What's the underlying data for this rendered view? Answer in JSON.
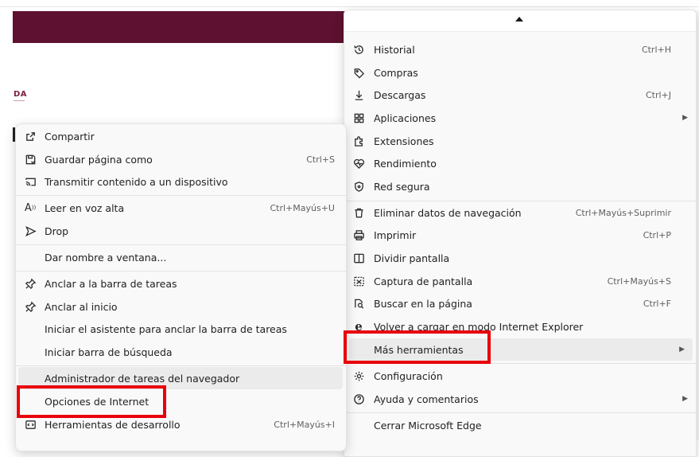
{
  "page": {
    "logo_text": "DA"
  },
  "context_menu": {
    "items": [
      {
        "icon": "share-icon",
        "label": "Compartir",
        "shortcut": ""
      },
      {
        "icon": "save-page-icon",
        "label": "Guardar página como",
        "shortcut": "Ctrl+S"
      },
      {
        "icon": "cast-icon",
        "label": "Transmitir contenido a un dispositivo",
        "shortcut": ""
      },
      {
        "icon": "read-aloud-icon",
        "label": "Leer en voz alta",
        "shortcut": "Ctrl+Mayús+U"
      },
      {
        "icon": "drop-icon",
        "label": "Drop",
        "shortcut": ""
      },
      {
        "icon": "",
        "label": "Dar nombre a ventana...",
        "shortcut": ""
      },
      {
        "icon": "pin-icon",
        "label": "Anclar a la barra de tareas",
        "shortcut": ""
      },
      {
        "icon": "pin-icon",
        "label": "Anclar al inicio",
        "shortcut": ""
      },
      {
        "icon": "",
        "label": "Iniciar el asistente para anclar la barra de tareas",
        "shortcut": ""
      },
      {
        "icon": "",
        "label": "Iniciar barra de búsqueda",
        "shortcut": ""
      },
      {
        "icon": "",
        "label": "Administrador de tareas del navegador",
        "shortcut": ""
      },
      {
        "icon": "",
        "label": "Opciones de Internet",
        "shortcut": ""
      },
      {
        "icon": "dev-tools-icon",
        "label": "Herramientas de desarrollo",
        "shortcut": "Ctrl+Mayús+I"
      }
    ]
  },
  "main_menu": {
    "items": [
      {
        "icon": "history-icon",
        "label": "Historial",
        "shortcut": "Ctrl+H"
      },
      {
        "icon": "tag-icon",
        "label": "Compras",
        "shortcut": ""
      },
      {
        "icon": "download-icon",
        "label": "Descargas",
        "shortcut": "Ctrl+J"
      },
      {
        "icon": "apps-icon",
        "label": "Aplicaciones",
        "shortcut": ""
      },
      {
        "icon": "extensions-icon",
        "label": "Extensiones",
        "shortcut": ""
      },
      {
        "icon": "performance-icon",
        "label": "Rendimiento",
        "shortcut": ""
      },
      {
        "icon": "shield-icon",
        "label": "Red segura",
        "shortcut": ""
      },
      {
        "icon": "trash-icon",
        "label": "Eliminar datos de navegación",
        "shortcut": "Ctrl+Mayús+Suprimir"
      },
      {
        "icon": "print-icon",
        "label": "Imprimir",
        "shortcut": "Ctrl+P"
      },
      {
        "icon": "split-screen-icon",
        "label": "Dividir pantalla",
        "shortcut": ""
      },
      {
        "icon": "screenshot-icon",
        "label": "Captura de pantalla",
        "shortcut": "Ctrl+Mayús+S"
      },
      {
        "icon": "find-icon",
        "label": "Buscar en la página",
        "shortcut": "Ctrl+F"
      },
      {
        "icon": "ie-icon",
        "label": "Volver a cargar en modo Internet Explorer",
        "shortcut": ""
      },
      {
        "icon": "",
        "label": "Más herramientas",
        "shortcut": ""
      },
      {
        "icon": "gear-icon",
        "label": "Configuración",
        "shortcut": ""
      },
      {
        "icon": "help-icon",
        "label": "Ayuda y comentarios",
        "shortcut": ""
      },
      {
        "icon": "",
        "label": "Cerrar Microsoft Edge",
        "shortcut": ""
      }
    ]
  },
  "colors": {
    "banner": "#5e1130",
    "highlight_box": "#e8000b"
  }
}
